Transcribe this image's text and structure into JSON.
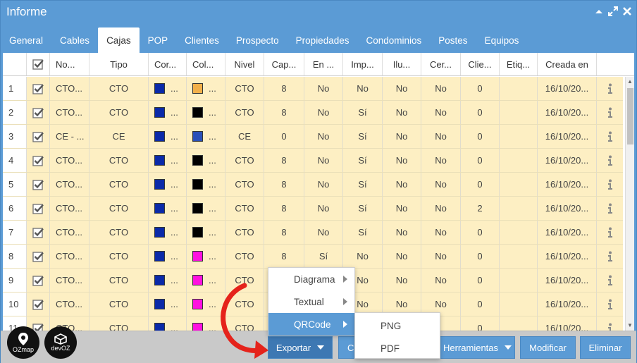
{
  "window": {
    "title": "Informe"
  },
  "tabs": [
    "General",
    "Cables",
    "Cajas",
    "POP",
    "Clientes",
    "Prospecto",
    "Propiedades",
    "Condominios",
    "Postes",
    "Equipos"
  ],
  "active_tab": "Cajas",
  "columns": [
    "No...",
    "Tipo",
    "Cor...",
    "Col...",
    "Nivel",
    "Cap...",
    "En ...",
    "Imp...",
    "Ilu...",
    "Cer...",
    "Clie...",
    "Etiq...",
    "Creada en"
  ],
  "ellipsis": "...",
  "rows": [
    {
      "n": "1",
      "name": "CTO...",
      "tipo": "CTO",
      "color1": "#0a2aa8",
      "color2": "#f2b04a",
      "nivel": "CTO",
      "cap": "8",
      "en": "No",
      "imp": "No",
      "ilu": "No",
      "cer": "No",
      "clie": "0",
      "etiq": "",
      "fecha": "16/10/20..."
    },
    {
      "n": "2",
      "name": "CTO...",
      "tipo": "CTO",
      "color1": "#0a2aa8",
      "color2": "#000000",
      "nivel": "CTO",
      "cap": "8",
      "en": "No",
      "imp": "Sí",
      "ilu": "No",
      "cer": "No",
      "clie": "0",
      "etiq": "",
      "fecha": "16/10/20..."
    },
    {
      "n": "3",
      "name": "CE - ...",
      "tipo": "CE",
      "color1": "#0a2aa8",
      "color2": "#2950b8",
      "nivel": "CE",
      "cap": "0",
      "en": "No",
      "imp": "Sí",
      "ilu": "No",
      "cer": "No",
      "clie": "0",
      "etiq": "",
      "fecha": "16/10/20..."
    },
    {
      "n": "4",
      "name": "CTO...",
      "tipo": "CTO",
      "color1": "#0a2aa8",
      "color2": "#000000",
      "nivel": "CTO",
      "cap": "8",
      "en": "No",
      "imp": "Sí",
      "ilu": "No",
      "cer": "No",
      "clie": "0",
      "etiq": "",
      "fecha": "16/10/20..."
    },
    {
      "n": "5",
      "name": "CTO...",
      "tipo": "CTO",
      "color1": "#0a2aa8",
      "color2": "#000000",
      "nivel": "CTO",
      "cap": "8",
      "en": "No",
      "imp": "Sí",
      "ilu": "No",
      "cer": "No",
      "clie": "0",
      "etiq": "",
      "fecha": "16/10/20..."
    },
    {
      "n": "6",
      "name": "CTO...",
      "tipo": "CTO",
      "color1": "#0a2aa8",
      "color2": "#000000",
      "nivel": "CTO",
      "cap": "8",
      "en": "No",
      "imp": "Sí",
      "ilu": "No",
      "cer": "No",
      "clie": "2",
      "etiq": "",
      "fecha": "16/10/20..."
    },
    {
      "n": "7",
      "name": "CTO...",
      "tipo": "CTO",
      "color1": "#0a2aa8",
      "color2": "#000000",
      "nivel": "CTO",
      "cap": "8",
      "en": "No",
      "imp": "Sí",
      "ilu": "No",
      "cer": "No",
      "clie": "0",
      "etiq": "",
      "fecha": "16/10/20..."
    },
    {
      "n": "8",
      "name": "CTO...",
      "tipo": "CTO",
      "color1": "#0a2aa8",
      "color2": "#ff10e0",
      "nivel": "CTO",
      "cap": "8",
      "en": "Sí",
      "imp": "No",
      "ilu": "No",
      "cer": "No",
      "clie": "0",
      "etiq": "",
      "fecha": "16/10/20..."
    },
    {
      "n": "9",
      "name": "CTO...",
      "tipo": "CTO",
      "color1": "#0a2aa8",
      "color2": "#ff10e0",
      "nivel": "CTO",
      "cap": "",
      "en": "",
      "imp": "No",
      "ilu": "No",
      "cer": "No",
      "clie": "0",
      "etiq": "",
      "fecha": "16/10/20..."
    },
    {
      "n": "10",
      "name": "CTO...",
      "tipo": "CTO",
      "color1": "#0a2aa8",
      "color2": "#ff10e0",
      "nivel": "CTO",
      "cap": "",
      "en": "",
      "imp": "No",
      "ilu": "No",
      "cer": "No",
      "clie": "0",
      "etiq": "",
      "fecha": "16/10/20..."
    },
    {
      "n": "11",
      "name": "CTO...",
      "tipo": "CTO",
      "color1": "#0a2aa8",
      "color2": "#ff10e0",
      "nivel": "CTO",
      "cap": "",
      "en": "",
      "imp": "",
      "ilu": "",
      "cer": "",
      "clie": "0",
      "etiq": "",
      "fecha": "16/10/20..."
    }
  ],
  "logos": {
    "ozmap": "OZmap",
    "devoz": "devOZ"
  },
  "footer": {
    "exportar": "Exportar",
    "cancelar": "Ca",
    "herramientas": "Herramientas",
    "modificar": "Modificar",
    "eliminar": "Eliminar"
  },
  "export_menu": [
    "Diagrama",
    "Textual",
    "QRCode"
  ],
  "export_menu_active": "QRCode",
  "qrcode_submenu": [
    "PNG",
    "PDF"
  ],
  "colors": {
    "accent": "#5b9bd5",
    "row_bg": "#fdefc3",
    "arrow": "#e5231b"
  }
}
